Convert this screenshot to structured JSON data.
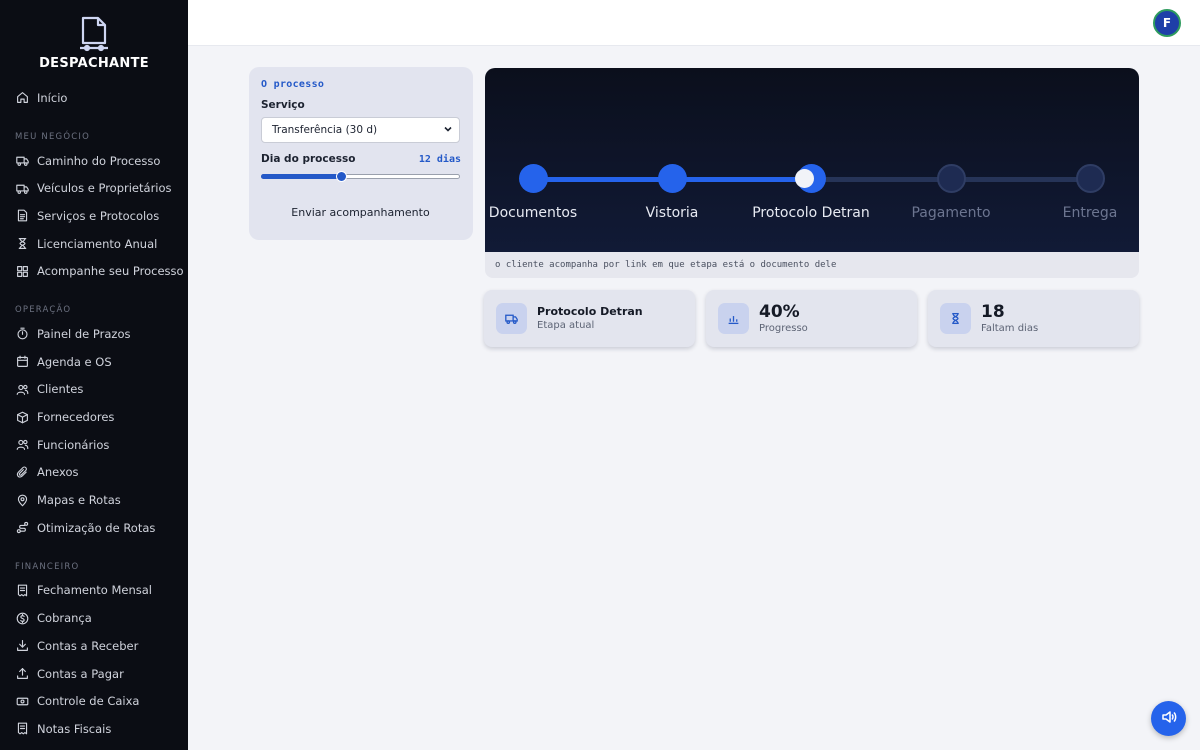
{
  "brand": {
    "name": "DESPACHANTE",
    "icon": "document-truck-icon"
  },
  "sidebar": {
    "home": {
      "label": "Início",
      "icon": "home-icon"
    },
    "sections": [
      {
        "title": "MEU NEGÓCIO",
        "items": [
          {
            "label": "Caminho do Processo",
            "icon": "truck-icon"
          },
          {
            "label": "Veículos e Proprietários",
            "icon": "truck-icon"
          },
          {
            "label": "Serviços e Protocolos",
            "icon": "document-icon"
          },
          {
            "label": "Licenciamento Anual",
            "icon": "hourglass-icon"
          },
          {
            "label": "Acompanhe seu Processo",
            "icon": "grid-icon"
          }
        ]
      },
      {
        "title": "OPERAÇÃO",
        "items": [
          {
            "label": "Painel de Prazos",
            "icon": "timer-icon"
          },
          {
            "label": "Agenda e OS",
            "icon": "calendar-icon"
          },
          {
            "label": "Clientes",
            "icon": "users-icon"
          },
          {
            "label": "Fornecedores",
            "icon": "box-icon"
          },
          {
            "label": "Funcionários",
            "icon": "users-icon"
          },
          {
            "label": "Anexos",
            "icon": "paperclip-icon"
          },
          {
            "label": "Mapas e Rotas",
            "icon": "map-pin-icon"
          },
          {
            "label": "Otimização de Rotas",
            "icon": "route-icon"
          }
        ]
      },
      {
        "title": "FINANCEIRO",
        "items": [
          {
            "label": "Fechamento Mensal",
            "icon": "receipt-icon"
          },
          {
            "label": "Cobrança",
            "icon": "dollar-circle-icon"
          },
          {
            "label": "Contas a Receber",
            "icon": "download-icon"
          },
          {
            "label": "Contas a Pagar",
            "icon": "upload-icon"
          },
          {
            "label": "Controle de Caixa",
            "icon": "cash-icon"
          },
          {
            "label": "Notas Fiscais",
            "icon": "receipt-icon"
          }
        ]
      }
    ]
  },
  "topbar": {
    "avatar_initial": "F"
  },
  "control": {
    "title": "O processo",
    "service_label": "Serviço",
    "service_value": "Transferência (30 d)",
    "day_label": "Dia do processo",
    "day_value": "12 dias",
    "day_progress": 0.4,
    "send_label": "Enviar acompanhamento"
  },
  "progress": {
    "steps": [
      {
        "label": "Documentos",
        "done": true
      },
      {
        "label": "Vistoria",
        "done": true
      },
      {
        "label": "Protocolo Detran",
        "done": true
      },
      {
        "label": "Pagamento",
        "done": false
      },
      {
        "label": "Entrega",
        "done": false
      }
    ],
    "current_position": 0.4,
    "caption": "o cliente acompanha por link em que etapa está o documento dele"
  },
  "stats": [
    {
      "value": "Protocolo Detran",
      "label": "Etapa atual",
      "icon": "truck-icon"
    },
    {
      "value": "40%",
      "label": "Progresso",
      "icon": "bar-chart-icon"
    },
    {
      "value": "18",
      "label": "Faltam dias",
      "icon": "hourglass-icon"
    }
  ],
  "fab": {
    "icon": "speaker-icon"
  },
  "colors": {
    "accent": "#2563eb",
    "sidebar_bg": "#0b0d14",
    "panel_bg": "#0e1430"
  }
}
